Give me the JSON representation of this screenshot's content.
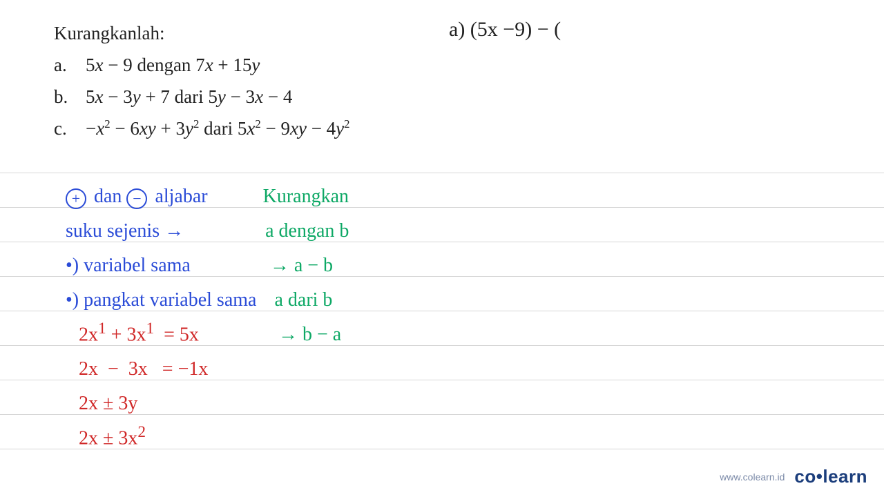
{
  "printed": {
    "heading": "Kurangkanlah:",
    "items": [
      {
        "marker": "a.",
        "expr_html": "5<span class='var'>x</span> − 9 dengan 7<span class='var'>x</span> + 15<span class='var'>y</span>"
      },
      {
        "marker": "b.",
        "expr_html": "5<span class='var'>x</span> − 3<span class='var'>y</span> + 7 dari 5<span class='var'>y</span> − 3<span class='var'>x</span> − 4"
      },
      {
        "marker": "c.",
        "expr_html": "−<span class='var'>x</span><sup>2</sup> − 6<span class='var'>xy</span> +  3<span class='var'>y</span><sup>2</sup> dari 5<span class='var'>x</span><sup>2</sup> − 9<span class='var'>xy</span> − 4<span class='var'>y</span><sup>2</sup>"
      }
    ]
  },
  "hand_top": "a) (5x −9) − (",
  "ruled_lines": [
    {
      "segments": [
        {
          "html": "<span class='circ'>+</span> dan <span class='circ'>−</span> aljabar",
          "cls": "blue",
          "pad": 0
        },
        {
          "text": "Kurangkan",
          "cls": "green",
          "pad": 80
        }
      ]
    },
    {
      "segments": [
        {
          "text": "suku sejenis →",
          "cls": "blue",
          "pad": 0
        },
        {
          "text": "a dengan b",
          "cls": "green",
          "pad": 118
        }
      ]
    },
    {
      "segments": [
        {
          "text": "•) variabel sama",
          "cls": "blue",
          "pad": 0
        },
        {
          "text": " → a − b",
          "cls": "green",
          "pad": 108
        }
      ]
    },
    {
      "segments": [
        {
          "text": "•) pangkat variabel sama",
          "cls": "blue",
          "pad": 0
        },
        {
          "text": "a dari b",
          "cls": "green",
          "pad": 26
        }
      ]
    },
    {
      "segments": [
        {
          "html": " 2x<sup>1</sup> + 3x<sup>1</sup>  = 5x",
          "cls": "red",
          "pad": 12
        },
        {
          "text": " → b − a",
          "cls": "green",
          "pad": 108
        }
      ]
    },
    {
      "segments": [
        {
          "text": " 2x  −  3x   = −1x",
          "cls": "red",
          "pad": 12
        }
      ]
    },
    {
      "segments": [
        {
          "text": " 2x ± 3y",
          "cls": "red",
          "pad": 12
        }
      ]
    },
    {
      "segments": [
        {
          "html": " 2x ± 3x<sup>2</sup>",
          "cls": "red",
          "pad": 12
        }
      ]
    }
  ],
  "footer": {
    "url": "www.colearn.id",
    "brand_left": "co",
    "brand_right": "learn"
  },
  "colors": {
    "blue": "#2a4bd7",
    "green": "#0da865",
    "red": "#d02828",
    "rule": "#d6d6d6",
    "brand": "#1c3e7c"
  }
}
